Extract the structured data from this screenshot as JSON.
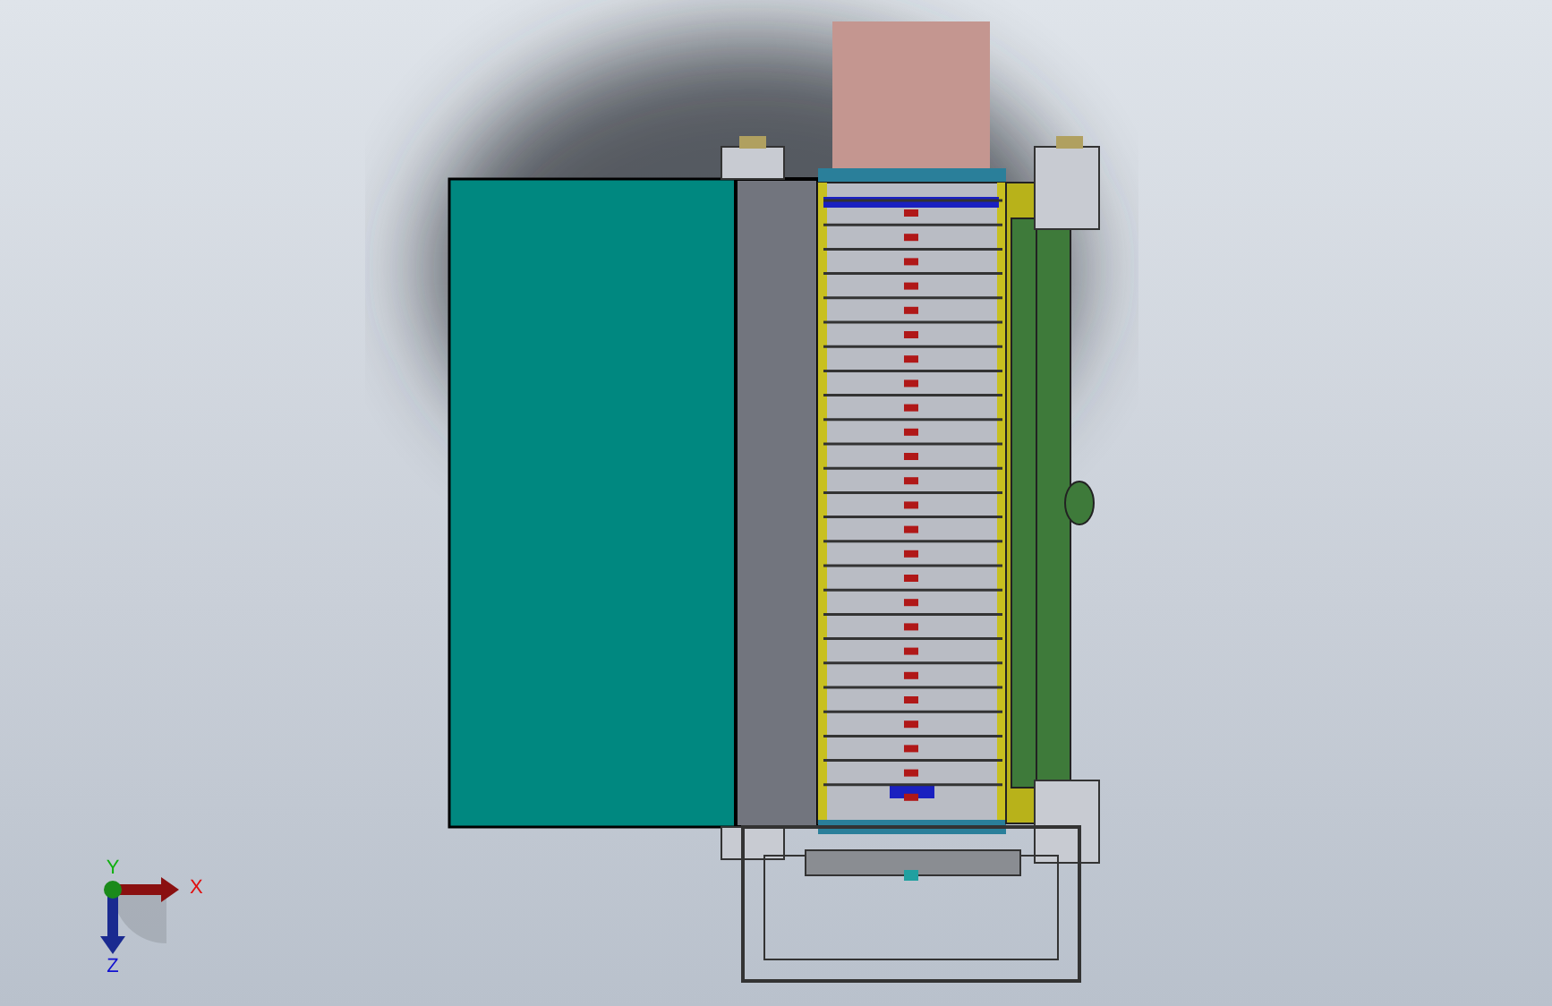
{
  "viewport": {
    "triad": {
      "axes": [
        {
          "kind": "x",
          "label": "X",
          "color": "#e01010"
        },
        {
          "kind": "y",
          "label": "Y",
          "color": "#10b010"
        },
        {
          "kind": "z",
          "label": "Z",
          "color": "#1010d0"
        }
      ]
    }
  }
}
